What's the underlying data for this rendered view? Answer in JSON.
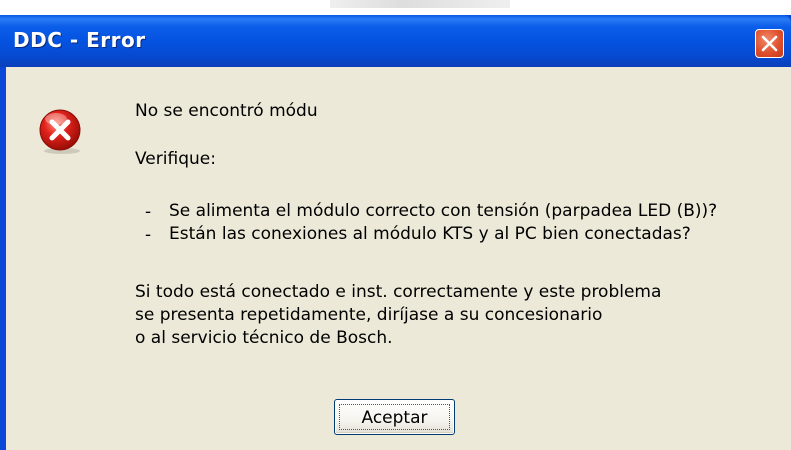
{
  "dialog": {
    "title": "DDC - Error",
    "close_icon": "close-icon",
    "error_icon": "error-icon",
    "line1": "No se encontró módu",
    "line2": "Verifique:",
    "bullet_char": "-",
    "bullet1": "Se alimenta el módulo correcto con tensión (parpadea LED (B))?",
    "bullet2": "Están las conexiones al módulo KTS y al PC bien conectadas?",
    "para1": "Si todo está conectado e inst. correctamente y este problema",
    "para2": "se presenta repetidamente, diríjase a su concesionario",
    "para3": "o al servicio técnico de Bosch.",
    "ok_label": "Aceptar"
  },
  "colors": {
    "titlebar": "#0553e1",
    "client_bg": "#ece9d8",
    "close_bg": "#e0502d",
    "error_red": "#e0231b"
  }
}
